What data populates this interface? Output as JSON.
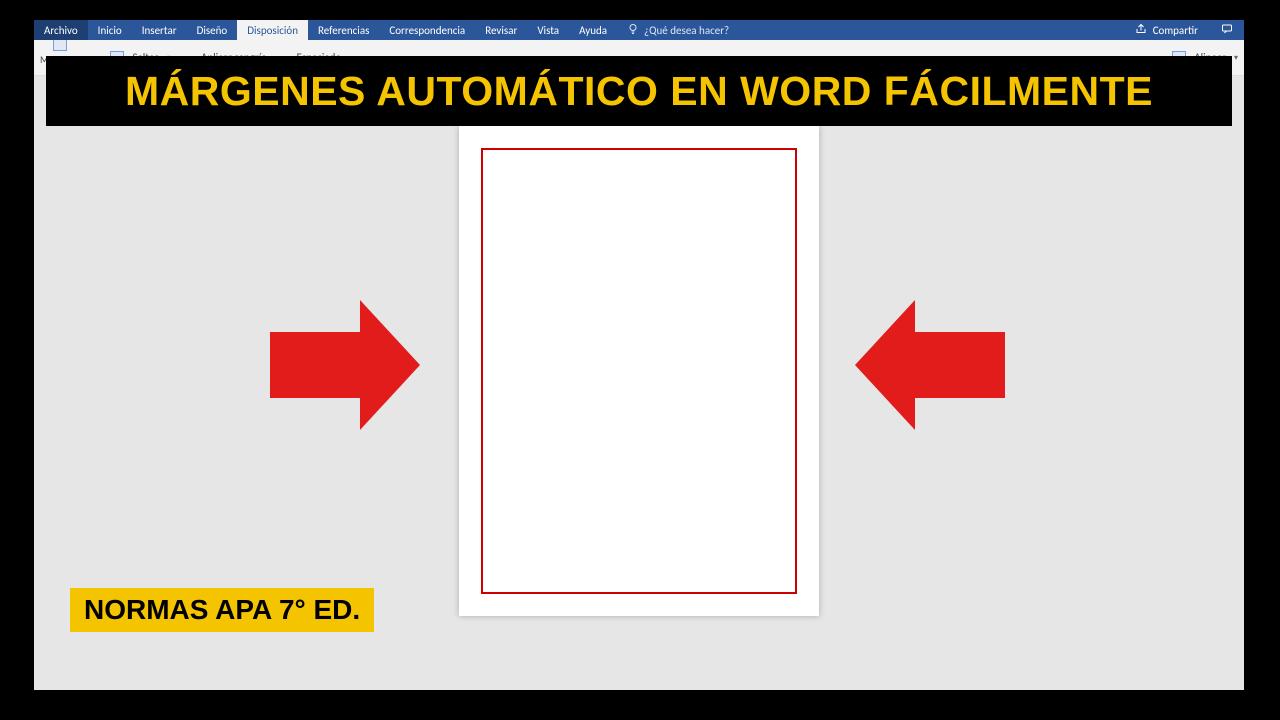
{
  "menu": {
    "file": "Archivo",
    "tabs": [
      "Inicio",
      "Insertar",
      "Diseño",
      "Disposición",
      "Referencias",
      "Correspondencia",
      "Revisar",
      "Vista",
      "Ayuda"
    ],
    "active_tab_index": 3,
    "tell_me": "¿Qué desea hacer?",
    "share": "Compartir"
  },
  "ribbon": {
    "margins_label": "Márgenes",
    "breaks_label": "Saltos",
    "indent_label": "Aplicar sangría",
    "spacing_label": "Espaciado",
    "align_label": "Alinear"
  },
  "overlay": {
    "title": "MÁRGENES AUTOMÁTICO EN WORD FÁCILMENTE",
    "apa": "NORMAS APA 7° ED."
  }
}
